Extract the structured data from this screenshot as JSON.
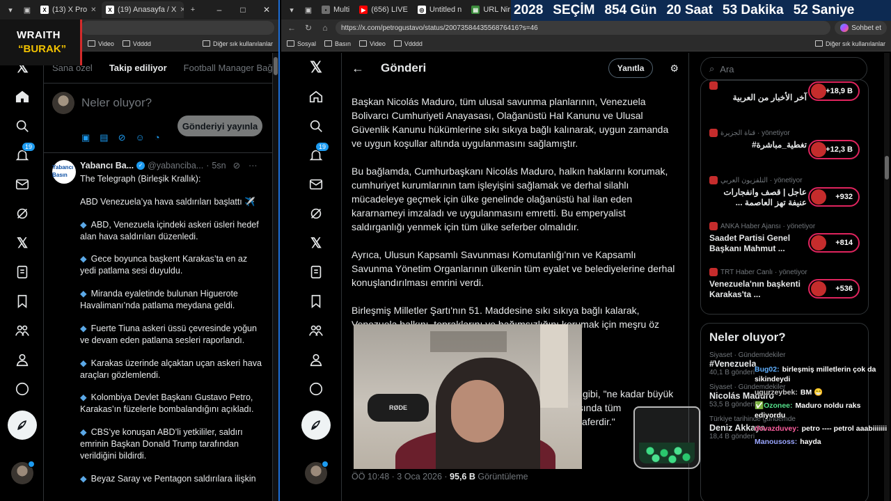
{
  "countdown": {
    "parts": [
      "2028",
      "SEÇİM",
      "854 Gün",
      "20 Saat",
      "53 Dakika",
      "52 Saniye"
    ]
  },
  "stream_logo": {
    "line1": "WRAITH",
    "line2": "“BURAK”"
  },
  "left_window": {
    "tabs": [
      {
        "label": "(13) X Pro",
        "active": false
      },
      {
        "label": "(19) Anasayfa / X",
        "active": true
      }
    ],
    "bookmarks": [
      "Video",
      "Vdddd",
      "Diğer sık kullanılanlar"
    ],
    "feed_tabs": [
      "Sana özel",
      "Takip ediliyor",
      "Football Manager Bağ"
    ],
    "composer_placeholder": "Neler oluyor?",
    "post_button": "Gönderiyi yayınla",
    "tweet": {
      "name": "Yabancı Ba...",
      "handle": "@yabanciba...",
      "time": "5sn",
      "avatar_text": "Yabancı Basın",
      "lines": [
        "The Telegraph (Birleşik Krallık):",
        "ABD Venezuela’ya hava saldırıları başlattı ✈️"
      ],
      "bullets": [
        "ABD, Venezuela içindeki askeri üsleri hedef alan hava saldırıları düzenledi.",
        "Gece boyunca başkent Karakas’ta en az yedi patlama sesi duyuldu.",
        "Miranda eyaletinde bulunan Higuerote Havalimanı’nda patlama meydana geldi.",
        "Fuerte Tiuna askeri üssü çevresinde yoğun ve devam eden patlama sesleri raporlandı.",
        "Karakas üzerinde alçaktan uçan askeri hava araçları gözlemlendi.",
        "Kolombiya Devlet Başkanı Gustavo Petro, Karakas’ın füzelerle bombalandığını açıkladı.",
        "CBS’ye konuşan ABD’li yetkililer, saldırı emrinin Başkan Donald Trump tarafından verildiğini bildirdi.",
        "Beyaz Saray ve Pentagon saldırılara ilişkin"
      ]
    },
    "notification_badge": "19"
  },
  "right_window": {
    "tabs": [
      {
        "label": "Multi",
        "active": false
      },
      {
        "label": "(656) LIVE",
        "active": false
      },
      {
        "label": "Untitled n",
        "active": false
      },
      {
        "label": "URL Nir",
        "active": false
      }
    ],
    "url": "https://x.com/petrogustavo/status/2007358443556876416?s=46",
    "sohbet": "Sohbet et",
    "bookmarks": [
      "Sosyal",
      "Basın",
      "Video",
      "Vdddd",
      "Diğer sık kullanılanlar"
    ],
    "notification_badge": "19",
    "header_title": "Gönderi",
    "reply_button": "Yanıtla",
    "paragraphs": [
      "Başkan Nicolás Maduro, tüm ulusal savunma planlarının, Venezuela Bolivarcı Cumhuriyeti Anayasası, Olağanüstü Hal Kanunu ve Ulusal Güvenlik Kanunu hükümlerine sıkı sıkıya bağlı kalınarak, uygun zamanda ve uygun koşullar altında uygulanmasını sağlamıştır.",
      "Bu bağlamda, Cumhurbaşkanı Nicolás Maduro, halkın haklarını korumak, cumhuriyet kurumlarının tam işleyişini sağlamak ve derhal silahlı mücadeleye geçmek için ülke genelinde olağanüstü hal ilan eden kararnameyi imzaladı ve uygulanmasını emretti. Bu emperyalist saldırganlığı yenmek için tüm ülke seferber olmalıdır.",
      "Ayrıca, Ulusun Kapsamlı Savunması Komutanlığı'nın ve Kapsamlı Savunma Yönetim Organlarının ülkenin tüm eyalet ve belediyelerine derhal konuşlandırılması emrini verdi.",
      "Birleşmiş Milletler Şartı'nın 51. Maddesine sıkı sıkıya bağlı kalarak, Venezuela halkını, topraklarını ve bağımsızlığını korumak için meşru öz"
    ],
    "partial_lines": [
      "gibi, \"ne kadar büyük",
      "asında tüm",
      "zaferdir.\""
    ],
    "meta": {
      "time": "ÖÖ 10:48 · 3 Oca 2026 · ",
      "views": "95,6 B",
      "views_label": " Görüntüleme"
    },
    "search_placeholder": "Ara",
    "live_items": [
      {
        "source": "",
        "text": "آخر الأخبار من العربية",
        "count": "+18,9 B"
      },
      {
        "source": "قناة الجزيرة · yönetiyor",
        "text": "تغطية_مباشرة#",
        "count": "+12,3 B"
      },
      {
        "source": "التلفزيون العربي · yönetiyor",
        "text": "عاجل | قصف وانفجارات عنيفة تهز العاصمة ...",
        "count": "+932"
      },
      {
        "source": "ANKA Haber Ajansı · yönetiyor",
        "text": "Saadet Partisi Genel Başkanı Mahmut ...",
        "count": "+814"
      },
      {
        "source": "TRT Haber Canlı · yönetiyor",
        "text": "Venezuela'nın başkenti Karakas'ta ...",
        "count": "+536"
      }
    ],
    "trends_title": "Neler oluyor?",
    "trends": [
      {
        "context": "Siyaset · Gündemdekiler",
        "name": "#Venezuela",
        "count": "40,1 B gönderi"
      },
      {
        "context": "Siyaset · Gündemdekiler",
        "name": "Nicolás Maduro",
        "count": "53,5 B gönderi"
      },
      {
        "context": "Türkiye tarihinde gündemde",
        "name": "Deniz Akkaya",
        "count": "18,4 B gönderi"
      }
    ]
  },
  "chat": [
    {
      "user": "Bug02:",
      "text": "birleşmiş milletlerin çok da sikindeydi",
      "color": "#5fb0ff"
    },
    {
      "user": "ugurzeybek:",
      "text": "BM 😁",
      "color": "#c9c9c9"
    },
    {
      "user": "✅Ozonee:",
      "text": "Maduro noldu raks ediyordu",
      "color": "#54e08a"
    },
    {
      "user": "dovazduvey:",
      "text": "petro ---- petrol aaabiiiiiii",
      "color": "#ff5fa0"
    },
    {
      "user": "Manousoss:",
      "text": "hayda",
      "color": "#9aa6ff"
    }
  ],
  "cam": {
    "mic_label": "RØDE"
  }
}
